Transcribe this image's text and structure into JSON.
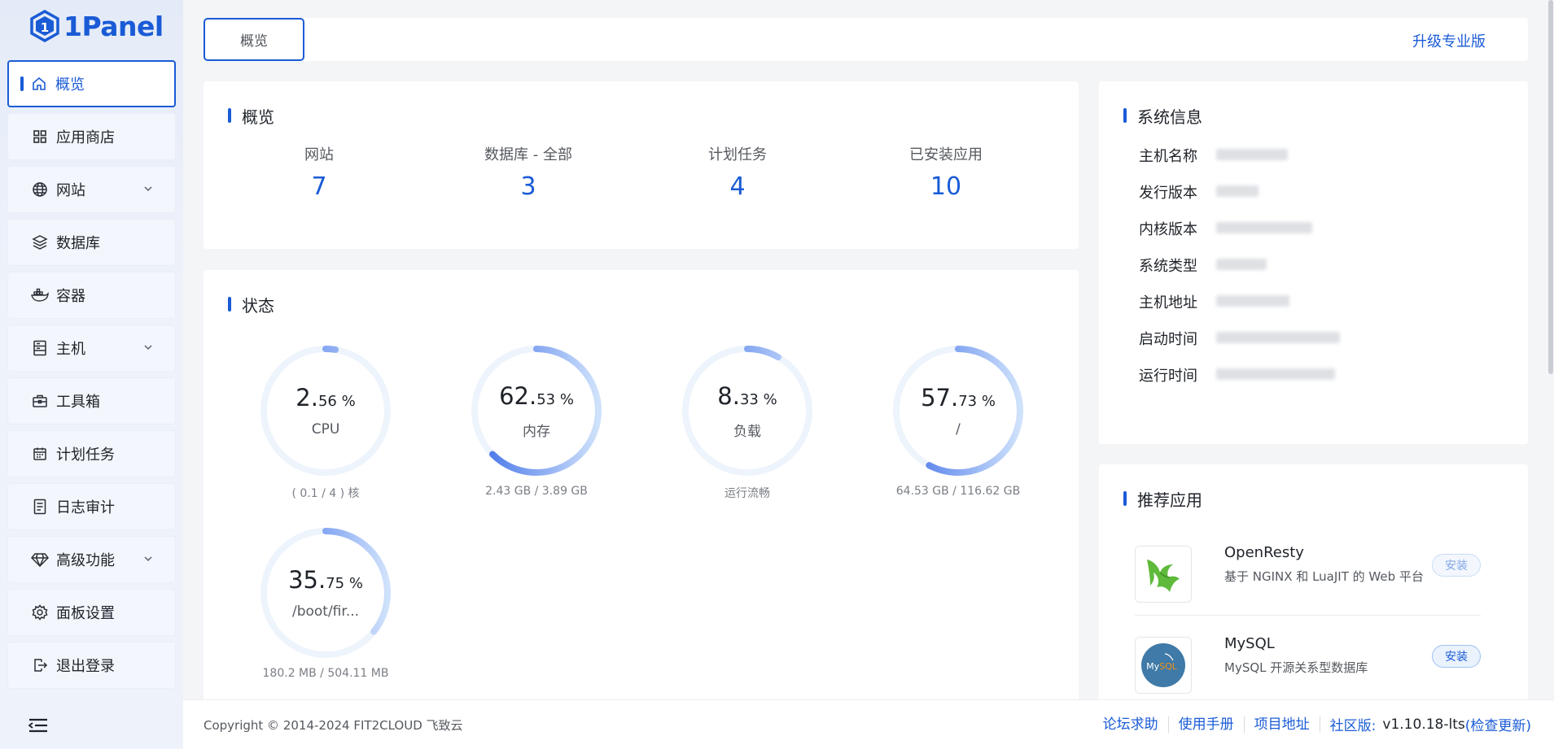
{
  "brand": {
    "name": "1Panel",
    "accent": "#1a5bd6"
  },
  "sidebar": {
    "items": [
      {
        "label": "概览",
        "icon": "home-icon",
        "active": true,
        "expandable": false
      },
      {
        "label": "应用商店",
        "icon": "grid-icon",
        "active": false,
        "expandable": false
      },
      {
        "label": "网站",
        "icon": "globe-icon",
        "active": false,
        "expandable": true
      },
      {
        "label": "数据库",
        "icon": "layers-icon",
        "active": false,
        "expandable": false
      },
      {
        "label": "容器",
        "icon": "docker-icon",
        "active": false,
        "expandable": false
      },
      {
        "label": "主机",
        "icon": "server-icon",
        "active": false,
        "expandable": true
      },
      {
        "label": "工具箱",
        "icon": "toolbox-icon",
        "active": false,
        "expandable": false
      },
      {
        "label": "计划任务",
        "icon": "calendar-icon",
        "active": false,
        "expandable": false
      },
      {
        "label": "日志审计",
        "icon": "log-icon",
        "active": false,
        "expandable": false
      },
      {
        "label": "高级功能",
        "icon": "diamond-icon",
        "active": false,
        "expandable": true
      },
      {
        "label": "面板设置",
        "icon": "gear-icon",
        "active": false,
        "expandable": false
      },
      {
        "label": "退出登录",
        "icon": "logout-icon",
        "active": false,
        "expandable": false
      }
    ]
  },
  "topbar": {
    "tab": "概览",
    "upgrade": "升级专业版"
  },
  "overview": {
    "title": "概览",
    "stats": [
      {
        "label": "网站",
        "value": "7"
      },
      {
        "label": "数据库 - 全部",
        "value": "3"
      },
      {
        "label": "计划任务",
        "value": "4"
      },
      {
        "label": "已安装应用",
        "value": "10"
      }
    ]
  },
  "status": {
    "title": "状态",
    "gauges": [
      {
        "int": "2.",
        "dec": "56 %",
        "name": "CPU",
        "foot": "( 0.1 / 4 ) 核",
        "percent": 2.56
      },
      {
        "int": "62.",
        "dec": "53 %",
        "name": "内存",
        "foot": "2.43 GB / 3.89 GB",
        "percent": 62.53
      },
      {
        "int": "8.",
        "dec": "33 %",
        "name": "负载",
        "foot": "运行流畅",
        "percent": 8.33
      },
      {
        "int": "57.",
        "dec": "73 %",
        "name": "/",
        "foot": "64.53 GB / 116.62 GB",
        "percent": 57.73
      },
      {
        "int": "35.",
        "dec": "75 %",
        "name": "/boot/fir...",
        "foot": "180.2 MB / 504.11 MB",
        "percent": 35.75
      }
    ]
  },
  "system_info": {
    "title": "系统信息",
    "rows": [
      {
        "label": "主机名称"
      },
      {
        "label": "发行版本"
      },
      {
        "label": "内核版本"
      },
      {
        "label": "系统类型"
      },
      {
        "label": "主机地址"
      },
      {
        "label": "启动时间"
      },
      {
        "label": "运行时间"
      }
    ]
  },
  "recommended": {
    "title": "推荐应用",
    "apps": [
      {
        "name": "OpenResty",
        "desc": "基于 NGINX 和 LuaJIT 的 Web 平台",
        "button": "安装",
        "disabled": true
      },
      {
        "name": "MySQL",
        "desc": "MySQL 开源关系型数据库",
        "button": "安装",
        "disabled": false
      }
    ]
  },
  "footer": {
    "copyright": "Copyright © 2014-2024 FIT2CLOUD 飞致云",
    "links": [
      "论坛求助",
      "使用手册",
      "项目地址"
    ],
    "edition": "社区版:",
    "version": "v1.10.18-lts",
    "check_update": "(检查更新)"
  }
}
